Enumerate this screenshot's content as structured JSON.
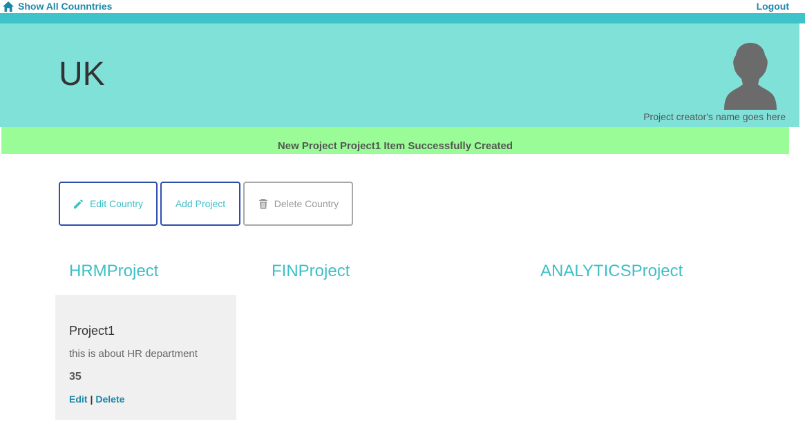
{
  "nav": {
    "home_label": "Show All Counntries",
    "home_icon": "home-icon",
    "logout_label": "Logout",
    "link_color": "#1e87a8"
  },
  "banner": {
    "country": "UK",
    "creator": "Project creator's name goes here",
    "avatar_icon": "user-silhouette-icon",
    "background": "#80e1d9"
  },
  "alert": {
    "message": "New Project Project1 Item Successfully Created",
    "background": "#9afc96"
  },
  "actions": {
    "edit_label": "Edit Country",
    "edit_icon": "pencil-icon",
    "add_label": "Add Project",
    "delete_label": "Delete Country",
    "delete_icon": "trash-icon"
  },
  "columns": [
    {
      "title": "HRMProject"
    },
    {
      "title": "FINProject"
    },
    {
      "title": "ANALYTICSProject"
    }
  ],
  "projects": [
    {
      "name": "Project1",
      "description": "this is about HR department",
      "count": "35",
      "edit_label": "Edit",
      "separator": "|",
      "delete_label": "Delete"
    }
  ],
  "colors": {
    "accent": "#3ebfc7",
    "strip": "#3ec4c8",
    "button_border": "#2f4eaa"
  }
}
